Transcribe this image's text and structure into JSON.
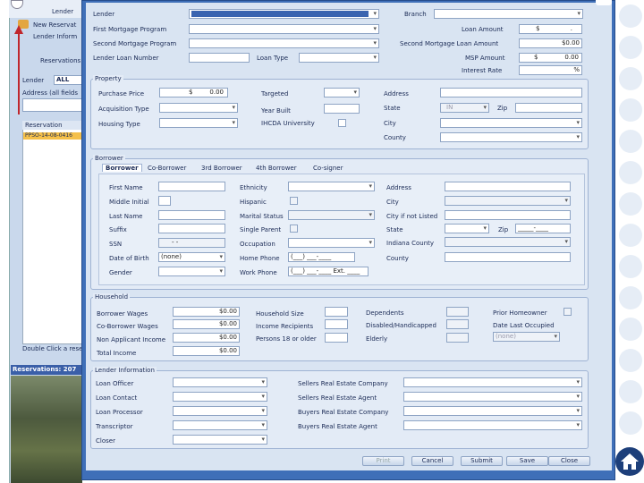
{
  "background": {
    "tab_lender": "Lender",
    "new_reservation": "New Reservat",
    "lender_info": "Lender Inform",
    "reservations_label": "Reservations",
    "lender_filter_label": "Lender",
    "lender_filter_value": "ALL",
    "address_label": "Address (all fields",
    "list_header": "Reservation",
    "list_selected": "PPSO-14-08-0416",
    "double_click_hint": "Double Click a reser",
    "reservations_count": "Reservations: 207"
  },
  "top": {
    "lender_label": "Lender",
    "branch_label": "Branch",
    "first_mortgage_label": "First Mortgage Program",
    "loan_amount_label": "Loan Amount",
    "loan_amount_currency": "$",
    "loan_amount_value": ".",
    "second_mortgage_label": "Second Mortgage Program",
    "second_mortgage_amount_label": "Second Mortgage Loan Amount",
    "second_mortgage_amount_value": "$0.00",
    "lender_loan_number_label": "Lender Loan Number",
    "loan_type_label": "Loan Type",
    "msp_amount_label": "MSP Amount",
    "msp_currency": "$",
    "msp_value": "0.00",
    "interest_rate_label": "Interest Rate",
    "interest_rate_value": "%"
  },
  "property": {
    "title": "Property",
    "purchase_price_label": "Purchase Price",
    "purchase_price_currency": "$",
    "purchase_price_value": "0.00",
    "targeted_label": "Targeted",
    "address_label": "Address",
    "acquisition_type_label": "Acquisition Type",
    "year_built_label": "Year Built",
    "state_label": "State",
    "state_value": "IN",
    "zip_label": "Zip",
    "housing_type_label": "Housing Type",
    "ihcda_label": "IHCDA University",
    "city_label": "City",
    "county_label": "County"
  },
  "borrower": {
    "title": "Borrower",
    "tabs": [
      "Borrower",
      "Co-Borrower",
      "3rd Borrower",
      "4th Borrower",
      "Co-signer"
    ],
    "first_name_label": "First Name",
    "ethnicity_label": "Ethnicity",
    "address_label": "Address",
    "middle_initial_label": "Middle Initial",
    "hispanic_label": "Hispanic",
    "city_label": "City",
    "last_name_label": "Last Name",
    "marital_status_label": "Marital Status",
    "city_not_listed_label": "City if not Listed",
    "suffix_label": "Suffix",
    "single_parent_label": "Single Parent",
    "state_label": "State",
    "zip_label": "Zip",
    "zip_mask": "_____-____",
    "ssn_label": "SSN",
    "ssn_mask": "-  -",
    "occupation_label": "Occupation",
    "indiana_county_label": "Indiana County",
    "dob_label": "Date of Birth",
    "dob_value": "(none)",
    "home_phone_label": "Home Phone",
    "home_phone_mask": "(___) ___-____",
    "county_label": "County",
    "gender_label": "Gender",
    "work_phone_label": "Work Phone",
    "work_phone_mask": "(___) ___-____ Ext. ____"
  },
  "household": {
    "title": "Household",
    "borrower_wages_label": "Borrower Wages",
    "borrower_wages_value": "$0.00",
    "household_size_label": "Household Size",
    "dependents_label": "Dependents",
    "prior_homeowner_label": "Prior Homeowner",
    "co_borrower_wages_label": "Co-Borrower Wages",
    "co_borrower_wages_value": "$0.00",
    "income_recipients_label": "Income Recipients",
    "disabled_label": "Disabled/Handicapped",
    "date_last_occupied_label": "Date Last Occupied",
    "date_last_occupied_value": "(none)",
    "non_applicant_label": "Non Applicant Income",
    "non_applicant_value": "$0.00",
    "persons_18_label": "Persons 18 or older",
    "elderly_label": "Elderly",
    "total_income_label": "Total Income",
    "total_income_value": "$0.00"
  },
  "lender_info": {
    "title": "Lender Information",
    "loan_officer_label": "Loan Officer",
    "sellers_company_label": "Sellers Real Estate Company",
    "loan_contact_label": "Loan Contact",
    "sellers_agent_label": "Sellers Real Estate Agent",
    "loan_processor_label": "Loan Processor",
    "buyers_company_label": "Buyers Real Estate Company",
    "transcriptor_label": "Transcriptor",
    "buyers_agent_label": "Buyers Real Estate Agent",
    "closer_label": "Closer"
  },
  "buttons": {
    "print": "Print",
    "cancel": "Cancel",
    "submit": "Submit",
    "save": "Save",
    "close": "Close"
  },
  "colors": {
    "dialog_border": "#3f6fb8",
    "form_bg": "#d9e4f2",
    "home_button": "#1d3f7a"
  }
}
